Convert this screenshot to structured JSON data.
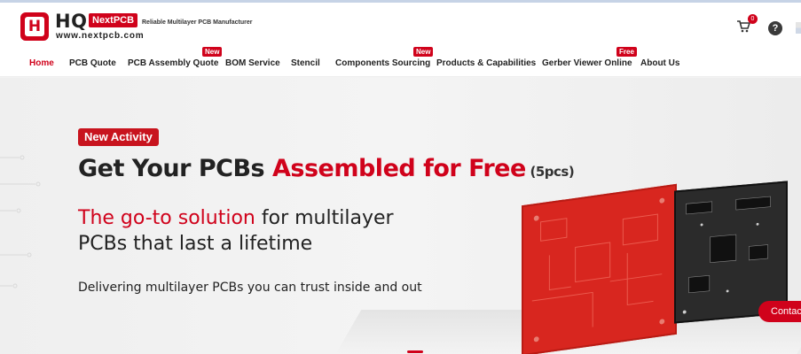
{
  "brand": {
    "logo_letter": "H",
    "logo_text": "HQ",
    "logo_badge": "NextPCB",
    "tagline": "Reliable Multilayer PCB Manufacturer",
    "url": "www.nextpcb.com"
  },
  "header": {
    "cart_count": "0",
    "help_label": "?"
  },
  "nav": {
    "items": [
      {
        "label": "Home",
        "badge": ""
      },
      {
        "label": "PCB Quote",
        "badge": ""
      },
      {
        "label": "PCB Assembly Quote",
        "badge": "New"
      },
      {
        "label": "BOM Service",
        "badge": ""
      },
      {
        "label": "Stencil",
        "badge": ""
      },
      {
        "label": "Components Sourcing",
        "badge": "New"
      },
      {
        "label": "Products & Capabilities",
        "badge": ""
      },
      {
        "label": "Gerber Viewer Online",
        "badge": "Free"
      },
      {
        "label": "About Us",
        "badge": ""
      }
    ]
  },
  "hero": {
    "badge": "New Activity",
    "headline_part1": "Get Your PCBs ",
    "headline_red": "Assembled for Free",
    "headline_small": " (5pcs)",
    "sub_red": "The go-to solution",
    "sub_rest": " for multilayer",
    "sub_line2": "PCBs that last a lifetime",
    "description": "Delivering multilayer PCBs you can trust inside and out"
  },
  "floating": {
    "contact_label": "Contac"
  },
  "colors": {
    "brand_red": "#d0021b",
    "text_dark": "#222222"
  }
}
